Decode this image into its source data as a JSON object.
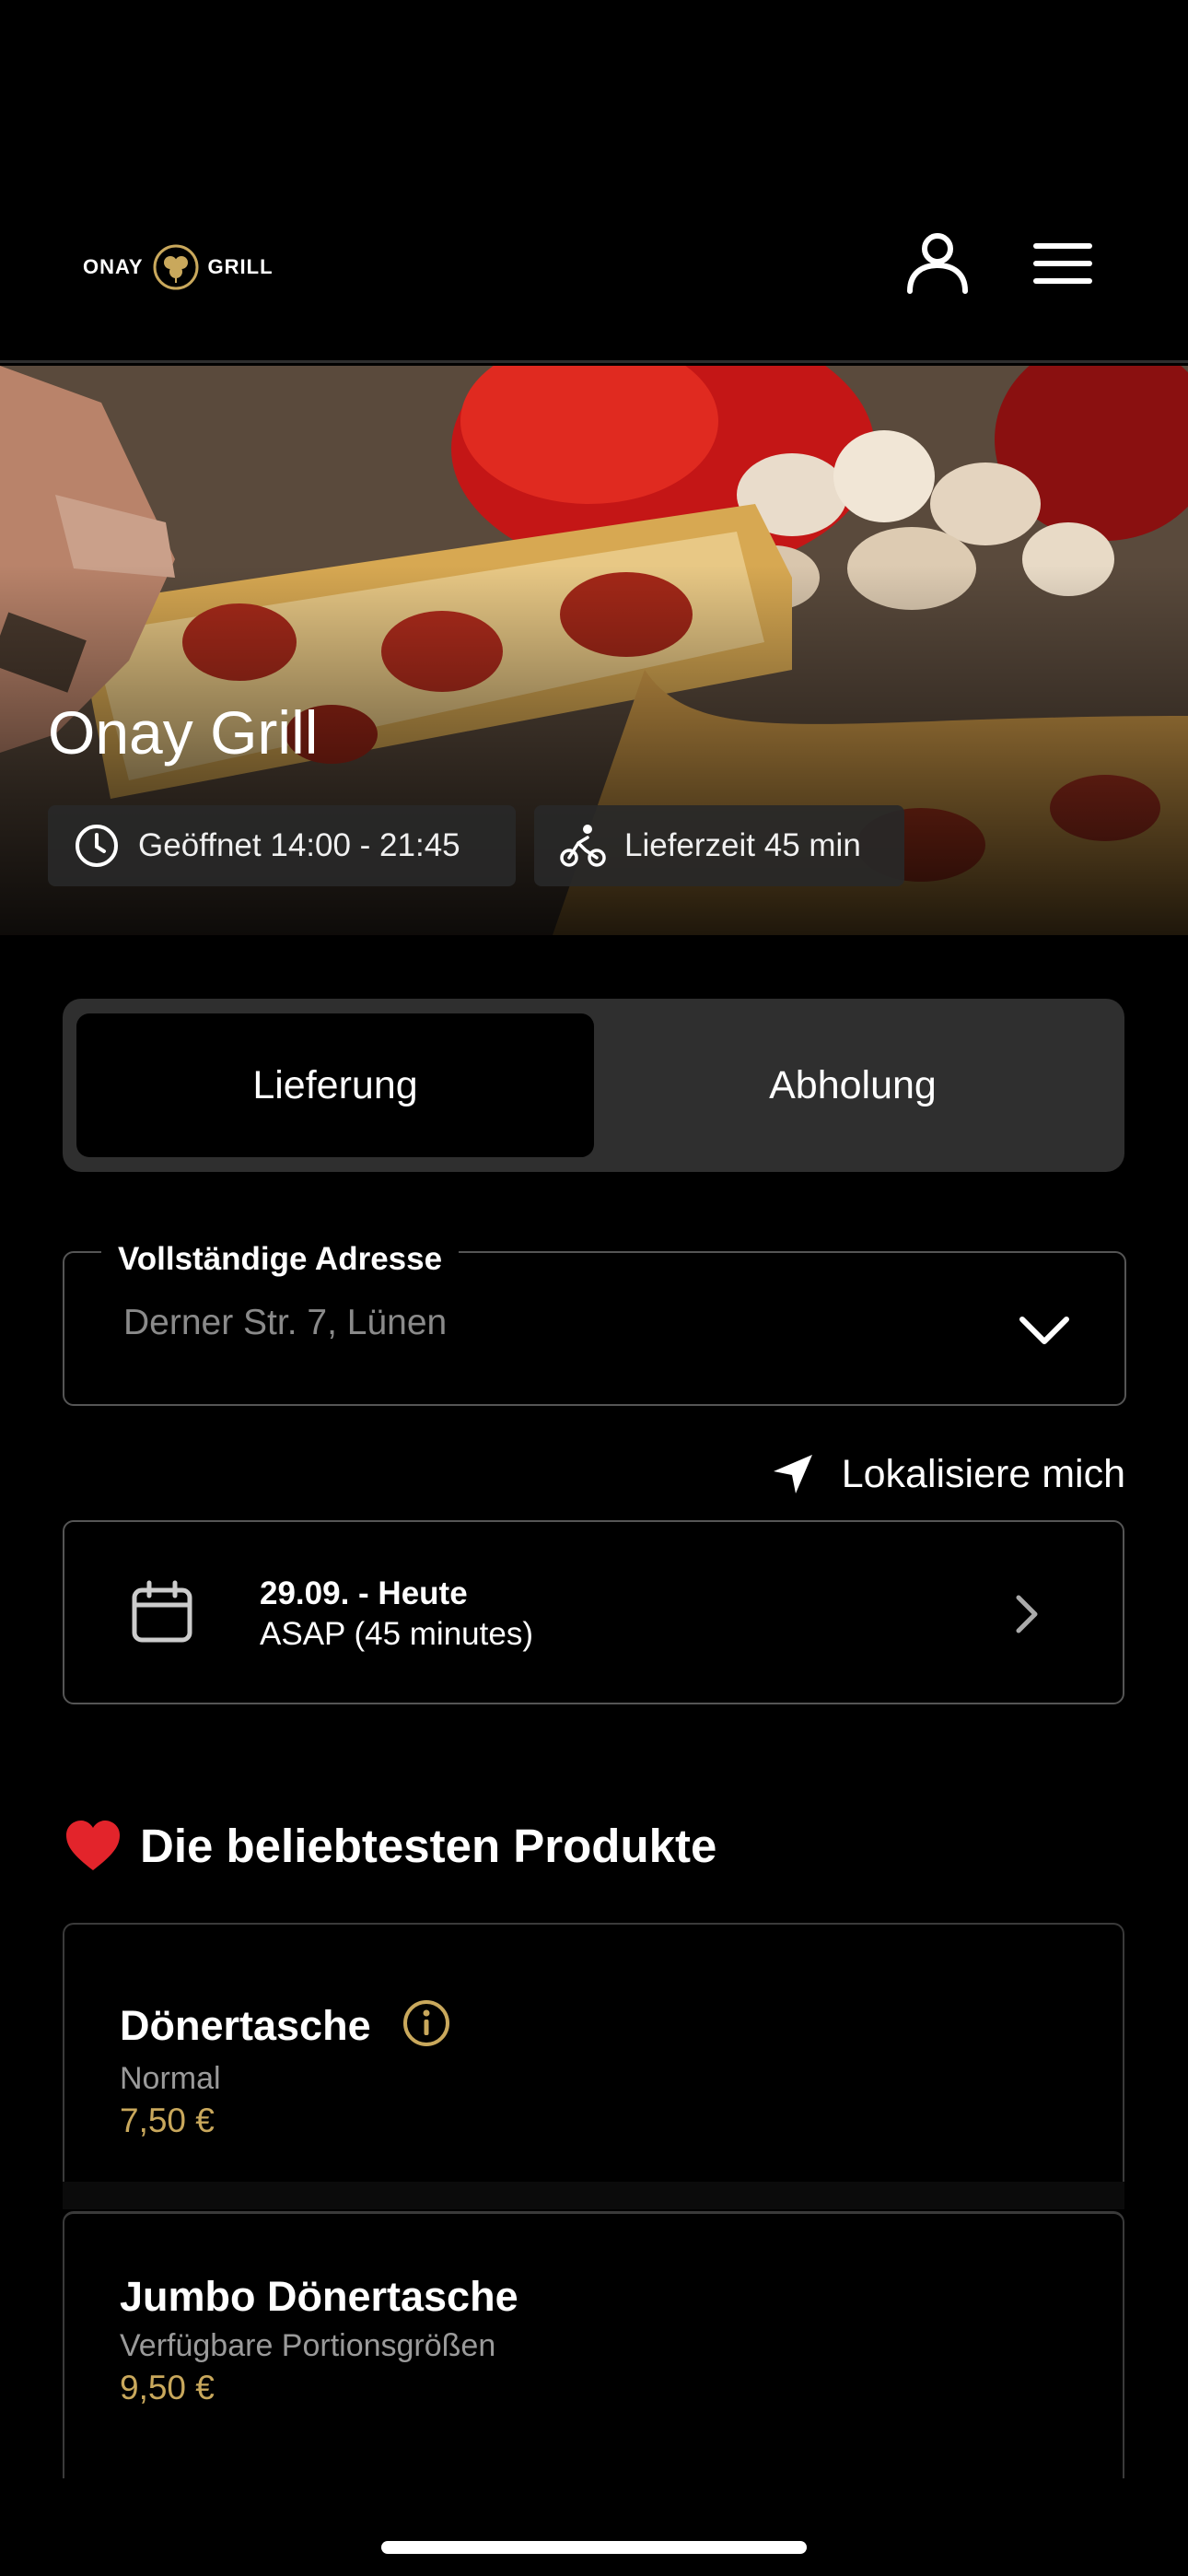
{
  "header": {
    "logo_left": "ONAY",
    "logo_right": "GRILL",
    "user_icon": "user-icon",
    "menu_icon": "hamburger-menu-icon"
  },
  "hero": {
    "title": "Onay Grill",
    "opening_hours": "Geöffnet 14:00 - 21:45",
    "delivery_time": "Lieferzeit 45 min"
  },
  "order_mode": {
    "tabs": [
      {
        "label": "Lieferung",
        "selected": true
      },
      {
        "label": "Abholung",
        "selected": false
      }
    ]
  },
  "address": {
    "label": "Vollständige Adresse",
    "placeholder": "Derner Str. 7, Lünen"
  },
  "locate": {
    "label": "Lokalisiere mich"
  },
  "schedule": {
    "date": "29.09. - Heute",
    "time": "ASAP (45 minutes)"
  },
  "popular": {
    "title": "Die beliebtesten Produkte",
    "items": [
      {
        "name": "Dönertasche",
        "variant": "Normal",
        "price": "7,50 €"
      },
      {
        "name": "Jumbo Dönertasche",
        "variant": "Verfügbare Portionsgrößen",
        "price": "9,50 €"
      }
    ]
  },
  "colors": {
    "accent_gold": "#c9a85c",
    "background": "#000000",
    "segment_bg": "#2f2f2f"
  }
}
